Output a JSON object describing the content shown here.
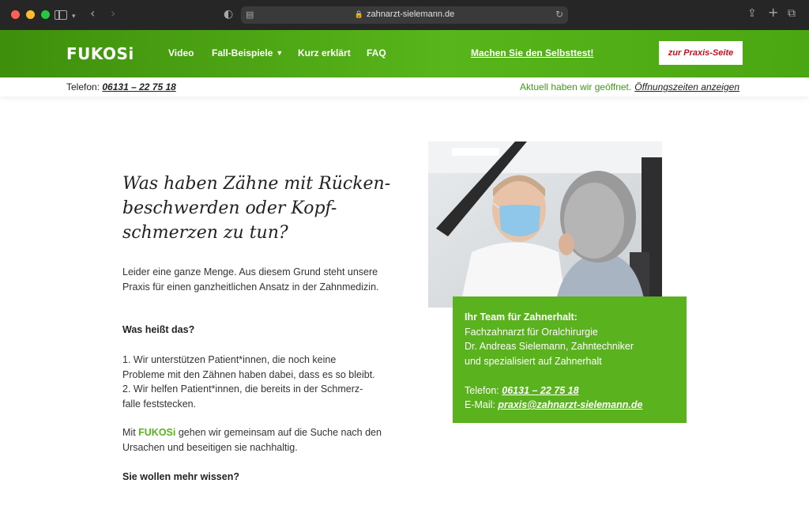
{
  "browser": {
    "url": "zahnarzt-sielemann.de"
  },
  "nav": {
    "logo": "FUKOSi",
    "items": [
      {
        "label": "Video"
      },
      {
        "label": "Fall-Beispiele"
      },
      {
        "label": "Kurz erklärt"
      },
      {
        "label": "FAQ"
      }
    ],
    "selbsttest": "Machen Sie den Selbsttest!",
    "praxis_button": "zur Praxis-Seite"
  },
  "infobar": {
    "phone_label": "Telefon:",
    "phone": "06131 – 22 75 18",
    "open_status": "Aktuell haben wir geöffnet.",
    "open_link": "Öffnungszeiten anzeigen"
  },
  "main": {
    "headline_1": "Was haben Zähne mit Rücken-",
    "headline_2": "beschwerden oder Kopf-",
    "headline_3": "schmerzen zu tun?",
    "p1": "Leider eine ganze Menge. Aus diesem Grund steht unsere Praxis für einen ganzheitlichen Ansatz in der Zahnmedizin.",
    "p2": "Was heißt das?",
    "p3_line1": "1. Wir unterstützen Patient*innen, die noch keine",
    "p3_line2": "Probleme mit den Zähnen haben dabei, dass es so bleibt.",
    "p3_line3": "2. Wir helfen Patient*innen, die bereits in der Schmerz-",
    "p3_line4": "falle feststecken.",
    "p4_prefix": "Mit ",
    "p4_brand": "FUKOSi",
    "p4_suffix": " gehen wir gemeinsam auf die Suche nach den Ursachen und beseitigen sie nachhaltig.",
    "p5": "Sie wollen mehr wissen?"
  },
  "team": {
    "title": "Ihr Team für Zahnerhalt:",
    "line1": "Fachzahnarzt für Oralchirurgie",
    "line2": "Dr. Andreas Sielemann, Zahntechniker",
    "line3": "und spezialisiert auf Zahnerhalt",
    "phone_label": "Telefon: ",
    "phone": "06131 – 22 75 18",
    "email_label": "E-Mail: ",
    "email": "praxis@zahnarzt-sielemann.de"
  },
  "colors": {
    "brand_green": "#5ab21e",
    "cta_red": "#c4121a"
  }
}
